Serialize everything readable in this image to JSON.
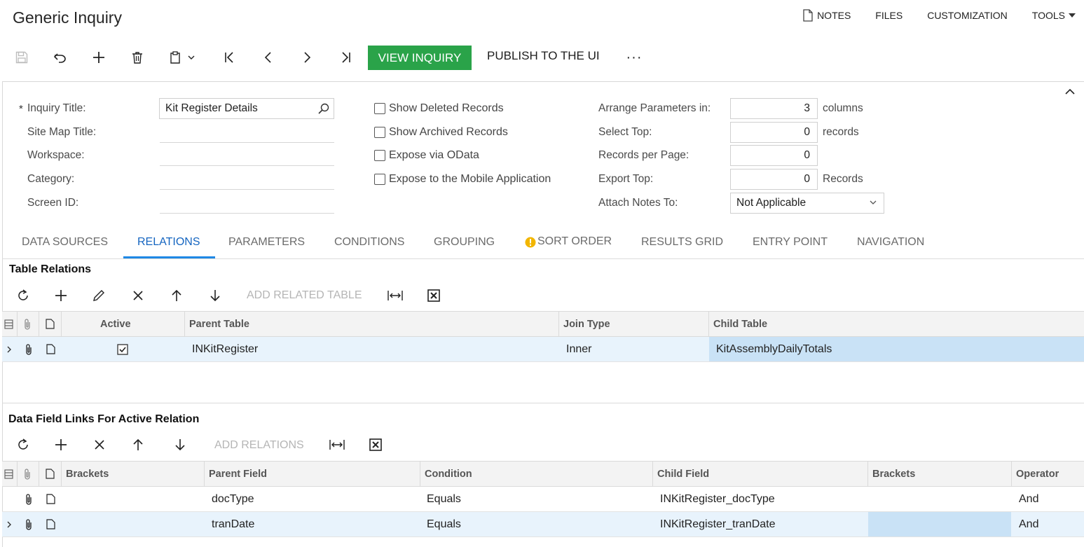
{
  "page": {
    "title": "Generic Inquiry"
  },
  "top_links": {
    "notes": "NOTES",
    "files": "FILES",
    "customization": "CUSTOMIZATION",
    "tools": "TOOLS"
  },
  "toolbar": {
    "view_inquiry": "VIEW INQUIRY",
    "publish": "PUBLISH TO THE UI",
    "more": "···"
  },
  "form": {
    "required_mark": "*",
    "inquiry_title_label": "Inquiry Title:",
    "inquiry_title_value": "Kit Register Details",
    "site_map_title_label": "Site Map Title:",
    "workspace_label": "Workspace:",
    "category_label": "Category:",
    "screen_id_label": "Screen ID:",
    "show_deleted": "Show Deleted Records",
    "show_archived": "Show Archived Records",
    "expose_odata": "Expose via OData",
    "expose_mobile": "Expose to the Mobile Application",
    "arrange_label": "Arrange Parameters in:",
    "arrange_value": "3",
    "arrange_unit": "columns",
    "select_top_label": "Select Top:",
    "select_top_value": "0",
    "select_top_unit": "records",
    "records_per_page_label": "Records per Page:",
    "records_per_page_value": "0",
    "export_top_label": "Export Top:",
    "export_top_value": "0",
    "export_top_unit": "Records",
    "attach_notes_label": "Attach Notes To:",
    "attach_notes_value": "Not Applicable"
  },
  "tabs": [
    "DATA SOURCES",
    "RELATIONS",
    "PARAMETERS",
    "CONDITIONS",
    "GROUPING",
    "SORT ORDER",
    "RESULTS GRID",
    "ENTRY POINT",
    "NAVIGATION"
  ],
  "table_relations": {
    "title": "Table Relations",
    "add_label": "ADD RELATED TABLE",
    "columns": {
      "active": "Active",
      "parent": "Parent Table",
      "join": "Join Type",
      "child": "Child Table"
    },
    "rows": [
      {
        "parent": "INKitRegister",
        "join": "Inner",
        "child": "KitAssemblyDailyTotals"
      }
    ]
  },
  "data_links": {
    "title": "Data Field Links For Active Relation",
    "add_label": "ADD RELATIONS",
    "columns": {
      "brackets1": "Brackets",
      "parent": "Parent Field",
      "condition": "Condition",
      "child": "Child Field",
      "brackets2": "Brackets",
      "operator": "Operator"
    },
    "rows": [
      {
        "parent": "docType",
        "condition": "Equals",
        "child": "INKitRegister_docType",
        "operator": "And"
      },
      {
        "parent": "tranDate",
        "condition": "Equals",
        "child": "INKitRegister_tranDate",
        "operator": "And"
      }
    ]
  },
  "colors": {
    "accent_green": "#2aa349",
    "accent_blue": "#1e88e5",
    "warning": "#f2b600"
  }
}
